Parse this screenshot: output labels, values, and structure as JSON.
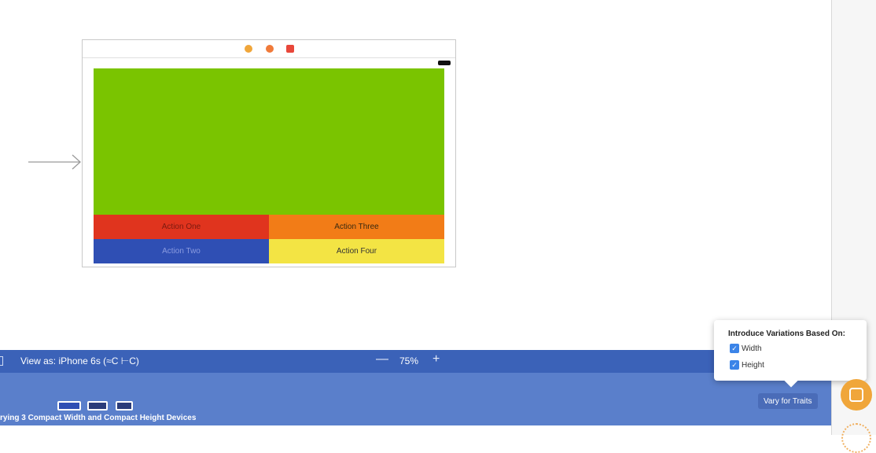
{
  "canvas": {
    "buttons": {
      "action_one": "Action One",
      "action_two": "Action Two",
      "action_three": "Action Three",
      "action_four": "Action Four"
    },
    "colors": {
      "main_view": "#7ac400",
      "action_one": "#e0341e",
      "action_two": "#2f4fb4",
      "action_three": "#f27c17",
      "action_four": "#f3e444"
    }
  },
  "bottom_bar": {
    "view_as": "View as: iPhone 6s (≈C ⊢C)",
    "zoom_out": "—",
    "zoom_level": "75%",
    "zoom_in": "+",
    "varying_text": "rying 3 Compact Width and Compact Height Devices",
    "vary_button": "Vary for Traits",
    "bar_color": "#3b62b8"
  },
  "popover": {
    "title": "Introduce Variations Based On:",
    "options": [
      {
        "label": "Width",
        "checked": true
      },
      {
        "label": "Height",
        "checked": true
      }
    ],
    "check_glyph": "✓"
  },
  "icons": {
    "dock": [
      "view-controller-icon",
      "first-responder-icon",
      "exit-icon"
    ],
    "entry": "arrow-right-icon",
    "library": "object-library-icon"
  }
}
